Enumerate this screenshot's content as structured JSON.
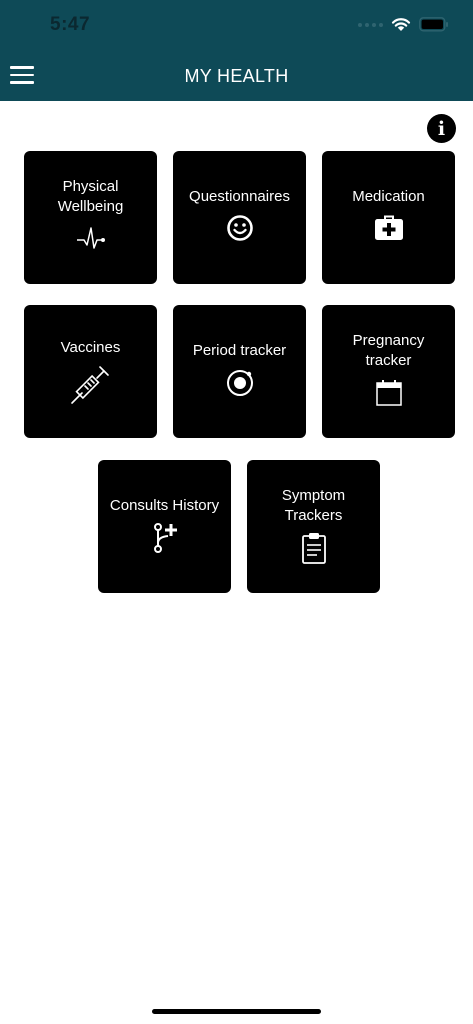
{
  "status_bar": {
    "time": "5:47"
  },
  "header": {
    "title": "MY HEALTH"
  },
  "tiles": [
    {
      "label": "Physical\nWellbeing",
      "icon": "heartbeat-icon"
    },
    {
      "label": "Questionnaires",
      "icon": "smiley-icon"
    },
    {
      "label": "Medication",
      "icon": "medical-kit-icon"
    },
    {
      "label": "Vaccines",
      "icon": "syringe-icon"
    },
    {
      "label": "Period tracker",
      "icon": "target-circle-icon"
    },
    {
      "label": "Pregnancy\ntracker",
      "icon": "calendar-icon"
    },
    {
      "label": "Consults History",
      "icon": "branch-plus-icon"
    },
    {
      "label": "Symptom\nTrackers",
      "icon": "clipboard-icon"
    }
  ],
  "colors": {
    "header_bg": "#0e4a57",
    "tile_bg": "#000000",
    "page_bg": "#ffffff"
  }
}
